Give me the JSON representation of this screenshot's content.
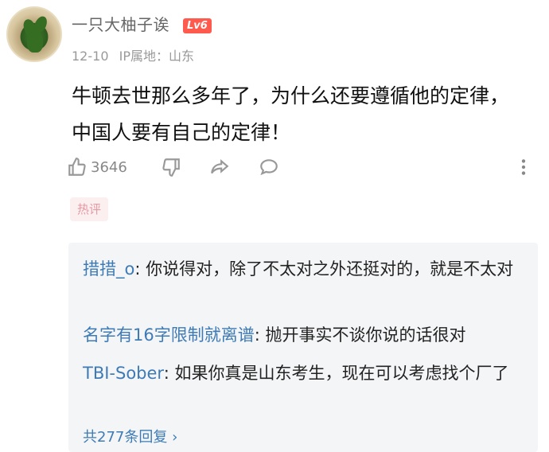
{
  "comment": {
    "username": "一只大柚子诶",
    "level": "Lv6",
    "date": "12-10",
    "ip_label": "IP属地：山东",
    "text_line1": "牛顿去世那么多年了，为什么还要遵循他的定律，",
    "text_line2": "中国人要有自己的定律！",
    "like_count": "3646",
    "hot_tag": "热评"
  },
  "icons": [
    "thumbs-up-icon",
    "thumbs-down-icon",
    "share-icon",
    "comment-bubble-icon",
    "more-vertical-icon"
  ],
  "replies": [
    {
      "author": "措措_o",
      "sep": ": ",
      "text": "你说得对，除了不太对之外还挺对的，就是不太对"
    },
    {
      "author": "名字有16字限制就离谱",
      "sep": ": ",
      "text": "抛开事实不谈你说的话很对"
    },
    {
      "author": "TBI-Sober",
      "sep": ": ",
      "text": "如果你真是山东考生，现在可以考虑找个厂了"
    }
  ],
  "more_replies": "共277条回复 ›",
  "colors": {
    "accent_blue": "#3e7bb5",
    "badge_red": "#ff5a4e",
    "hot_pink": "#e49aa3",
    "reply_bg": "#f4f5f7"
  }
}
